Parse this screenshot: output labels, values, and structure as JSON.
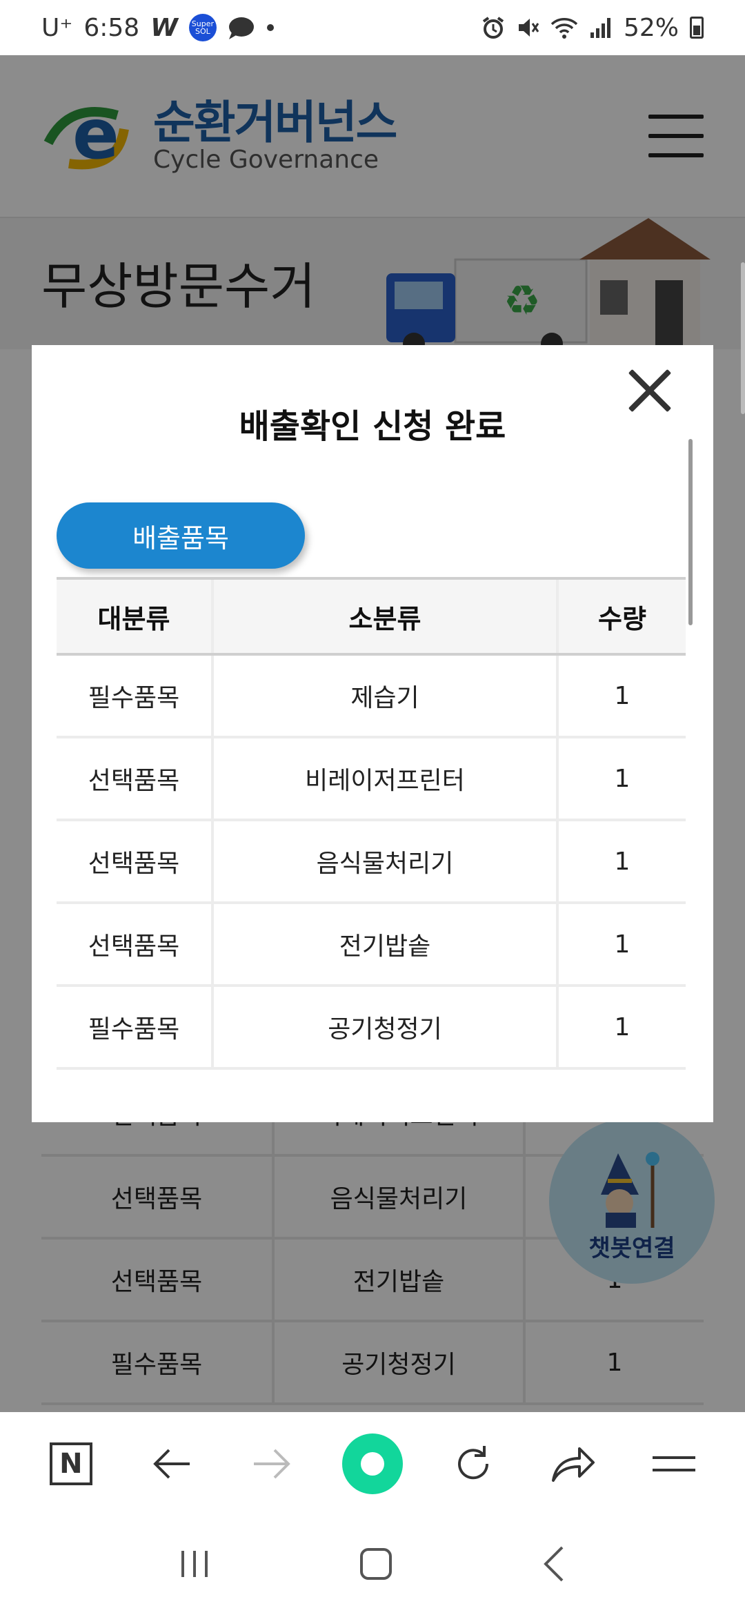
{
  "status_bar": {
    "carrier": "U⁺",
    "time": "6:58",
    "app_letter": "W",
    "sol_badge": "Super SOL",
    "battery": "52%"
  },
  "site": {
    "logo_korean": "순환거버넌스",
    "logo_english": "Cycle Governance",
    "hero_title": "무상방문수거"
  },
  "modal": {
    "title": "배출확인 신청 완료",
    "tag_button": "배출품목",
    "table": {
      "headers": [
        "대분류",
        "소분류",
        "수량"
      ],
      "rows": [
        [
          "필수품목",
          "제습기",
          "1"
        ],
        [
          "선택품목",
          "비레이저프린터",
          "1"
        ],
        [
          "선택품목",
          "음식물처리기",
          "1"
        ],
        [
          "선택품목",
          "전기밥솥",
          "1"
        ],
        [
          "필수품목",
          "공기청정기",
          "1"
        ]
      ]
    }
  },
  "background_table": {
    "rows": [
      [
        "선택품목",
        "비레이저프린터",
        ""
      ],
      [
        "선택품목",
        "음식물처리기",
        ""
      ],
      [
        "선택품목",
        "전기밥솥",
        "1"
      ],
      [
        "필수품목",
        "공기청정기",
        "1"
      ]
    ]
  },
  "chatbot": {
    "label": "챗봇연결"
  },
  "colors": {
    "brand_blue": "#1c86cf",
    "logo_blue": "#1e5fa6",
    "logo_green": "#2f9a3c",
    "browser_green": "#12d69b"
  }
}
